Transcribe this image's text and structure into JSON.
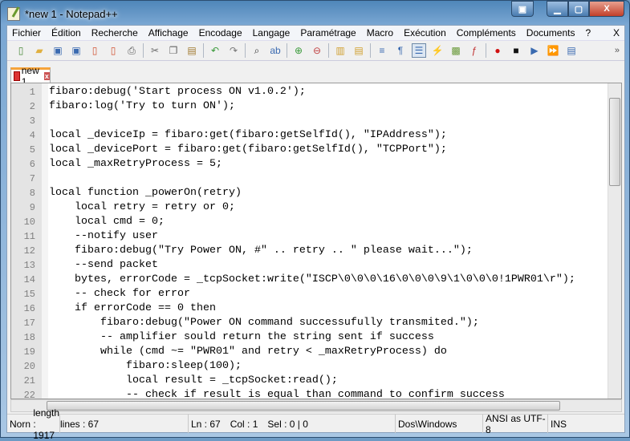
{
  "window": {
    "title": "*new  1 - Notepad++"
  },
  "menu": [
    "Fichier",
    "Édition",
    "Recherche",
    "Affichage",
    "Encodage",
    "Langage",
    "Paramétrage",
    "Macro",
    "Exécution",
    "Compléments",
    "Documents",
    "?"
  ],
  "menu_close": "X",
  "toolbar": [
    {
      "icon": "new-file-icon",
      "g": "▯",
      "c": "#4a8a3a"
    },
    {
      "icon": "open-file-icon",
      "g": "▰",
      "c": "#e0b040"
    },
    {
      "icon": "save-icon",
      "g": "▣",
      "c": "#3a6ab0"
    },
    {
      "icon": "save-all-icon",
      "g": "▣",
      "c": "#3a6ab0"
    },
    {
      "icon": "close-icon",
      "g": "▯",
      "c": "#d05030"
    },
    {
      "icon": "close-all-icon",
      "g": "▯",
      "c": "#d05030"
    },
    {
      "icon": "print-icon",
      "g": "⎙",
      "c": "#555"
    },
    {
      "sep": true
    },
    {
      "icon": "cut-icon",
      "g": "✂",
      "c": "#666"
    },
    {
      "icon": "copy-icon",
      "g": "❐",
      "c": "#666"
    },
    {
      "icon": "paste-icon",
      "g": "▤",
      "c": "#a07a30"
    },
    {
      "sep": true
    },
    {
      "icon": "undo-icon",
      "g": "↶",
      "c": "#3a9a3a"
    },
    {
      "icon": "redo-icon",
      "g": "↷",
      "c": "#777"
    },
    {
      "sep": true
    },
    {
      "icon": "find-icon",
      "g": "⌕",
      "c": "#333"
    },
    {
      "icon": "replace-icon",
      "g": "ab",
      "c": "#3a6ab0"
    },
    {
      "sep": true
    },
    {
      "icon": "zoom-in-icon",
      "g": "⊕",
      "c": "#3a9a3a"
    },
    {
      "icon": "zoom-out-icon",
      "g": "⊖",
      "c": "#c04040"
    },
    {
      "sep": true
    },
    {
      "icon": "sync-vertical-icon",
      "g": "▥",
      "c": "#d0a030"
    },
    {
      "icon": "sync-horizontal-icon",
      "g": "▤",
      "c": "#d0a030"
    },
    {
      "sep": true
    },
    {
      "icon": "word-wrap-icon",
      "g": "≡",
      "c": "#3a6ab0"
    },
    {
      "icon": "show-all-characters-icon",
      "g": "¶",
      "c": "#3a6ab0"
    },
    {
      "icon": "indent-guide-icon",
      "g": "☰",
      "c": "#3a6ab0",
      "active": true
    },
    {
      "icon": "user-language-icon",
      "g": "⚡",
      "c": "#d0a030"
    },
    {
      "icon": "document-map-icon",
      "g": "▩",
      "c": "#6a9a3a"
    },
    {
      "icon": "function-list-icon",
      "g": "ƒ",
      "c": "#c03030"
    },
    {
      "sep": true
    },
    {
      "icon": "record-macro-icon",
      "g": "●",
      "c": "#d01010"
    },
    {
      "icon": "stop-macro-icon",
      "g": "■",
      "c": "#111"
    },
    {
      "icon": "play-macro-icon",
      "g": "▶",
      "c": "#3a6ab0"
    },
    {
      "icon": "play-macro-multiple-icon",
      "g": "⏩",
      "c": "#3a6ab0"
    },
    {
      "icon": "save-macro-icon",
      "g": "▤",
      "c": "#3a6ab0"
    }
  ],
  "toolbar_more": "»",
  "tab": {
    "label": "new  1",
    "close": "x"
  },
  "lines": [
    "fibaro:debug('Start process ON v1.0.2');",
    "fibaro:log('Try to turn ON');",
    "",
    "local _deviceIp = fibaro:get(fibaro:getSelfId(), \"IPAddress\");",
    "local _devicePort = fibaro:get(fibaro:getSelfId(), \"TCPPort\");",
    "local _maxRetryProcess = 5;",
    "",
    "local function _powerOn(retry)",
    "    local retry = retry or 0;",
    "    local cmd = 0;",
    "    --notify user",
    "    fibaro:debug(\"Try Power ON, #\" .. retry .. \" please wait...\");",
    "    --send packet",
    "    bytes, errorCode = _tcpSocket:write(\"ISCP\\0\\0\\0\\16\\0\\0\\0\\9\\1\\0\\0\\0!1PWR01\\r\");",
    "    -- check for error",
    "    if errorCode == 0 then",
    "        fibaro:debug(\"Power ON command successufully transmited.\");",
    "        -- amplifier sould return the string sent if success",
    "        while (cmd ~= \"PWR01\" and retry < _maxRetryProcess) do",
    "            fibaro:sleep(100);",
    "            local result = _tcpSocket:read();",
    "            -- check if result is equal than command to confirm success"
  ],
  "status": {
    "type": "Norn",
    "length": "length : 1917",
    "lines": "lines : 67",
    "ln": "Ln : 67",
    "col": "Col : 1",
    "sel": "Sel : 0 | 0",
    "eol": "Dos\\Windows",
    "encoding": "ANSI as UTF-8",
    "mode": "INS"
  }
}
